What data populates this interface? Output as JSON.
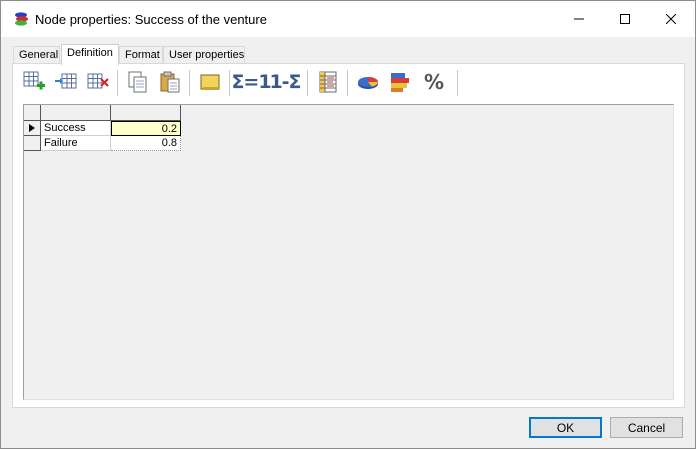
{
  "window": {
    "title": "Node properties: Success of the venture"
  },
  "tabs": [
    {
      "label": "General",
      "active": false
    },
    {
      "label": "Definition",
      "active": true
    },
    {
      "label": "Format",
      "active": false
    },
    {
      "label": "User properties",
      "active": false
    }
  ],
  "toolbar": {
    "items": [
      {
        "icon": "add-outcome-icon"
      },
      {
        "icon": "insert-outcome-icon"
      },
      {
        "icon": "delete-outcome-icon"
      },
      {
        "icon": "copy-icon"
      },
      {
        "icon": "paste-icon"
      },
      {
        "icon": "fill-icon"
      },
      {
        "icon": "sum-to-one-icon",
        "text": "Σ=1"
      },
      {
        "icon": "complement-icon",
        "text": "1-Σ"
      },
      {
        "icon": "table-view-icon"
      },
      {
        "icon": "pie-chart-icon"
      },
      {
        "icon": "bar-chart-icon"
      },
      {
        "icon": "percent-icon",
        "text": "%"
      }
    ]
  },
  "grid": {
    "rows": [
      {
        "outcome": "Success",
        "value": "0.2",
        "current": true
      },
      {
        "outcome": "Failure",
        "value": "0.8",
        "current": false
      }
    ]
  },
  "buttons": {
    "ok": "OK",
    "cancel": "Cancel"
  },
  "colors": {
    "selected_cell": "#ffffcc",
    "default_button_border": "#0078d7",
    "sigma": "#3a5a8c"
  }
}
